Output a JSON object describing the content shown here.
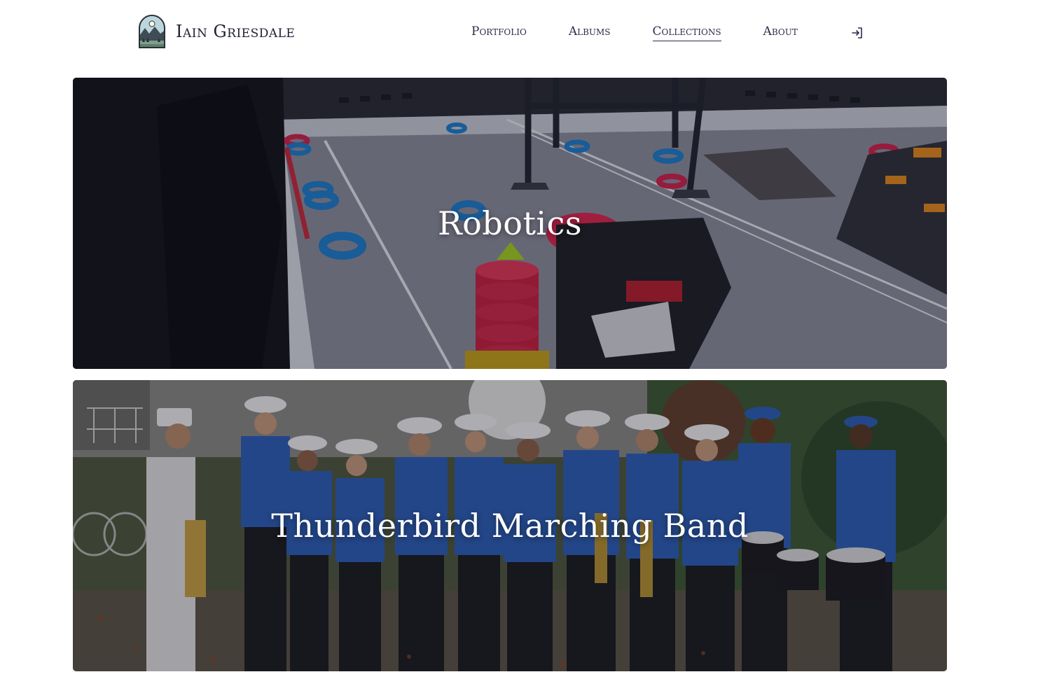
{
  "site": {
    "name": "Iain Griesdale",
    "logo_icon": "mountain-lake-badge-icon"
  },
  "nav": {
    "items": [
      {
        "label": "Portfolio",
        "active": false
      },
      {
        "label": "Albums",
        "active": false
      },
      {
        "label": "Collections",
        "active": true
      },
      {
        "label": "About",
        "active": false
      }
    ],
    "login_icon": "sign-in-icon"
  },
  "collections": [
    {
      "title": "Robotics"
    },
    {
      "title": "Thunderbird Marching Band"
    }
  ],
  "colors": {
    "text": "#1c2030",
    "nav_text": "#2a2e48",
    "card_title": "#ffffff",
    "background": "#ffffff"
  }
}
